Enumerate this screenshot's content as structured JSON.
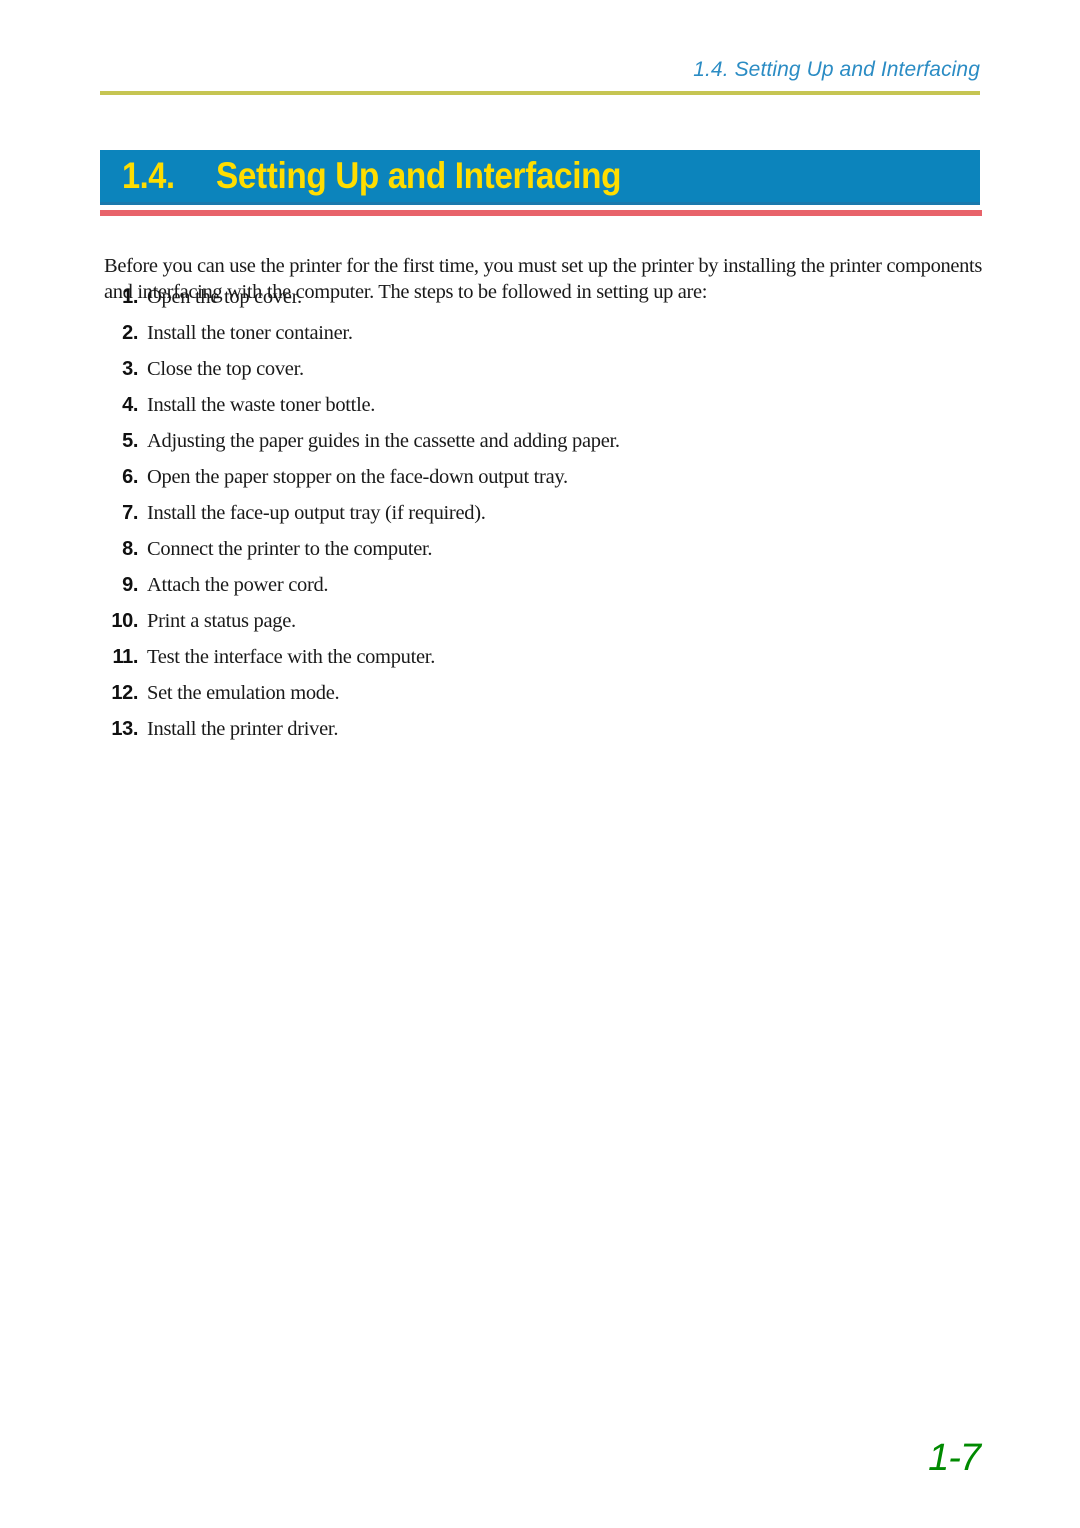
{
  "document": {
    "running_header": "1.4. Setting Up and Interfacing",
    "page_number": "1-7"
  },
  "section": {
    "number": "1.4.",
    "title": "Setting Up and Interfacing"
  },
  "body": {
    "intro": "Before you can use the printer for the first time, you must set up the printer by installing the printer components and interfacing with the computer. The steps to be followed in setting up are:"
  },
  "steps": [
    {
      "number": "1.",
      "label": "Open the top cover."
    },
    {
      "number": "2.",
      "label": "Install the toner container."
    },
    {
      "number": "3.",
      "label": "Close the top cover."
    },
    {
      "number": "4.",
      "label": "Install the waste toner bottle."
    },
    {
      "number": "5.",
      "label": "Adjusting the paper guides in the cassette and adding paper."
    },
    {
      "number": "6.",
      "label": "Open the paper stopper on the face-down output tray."
    },
    {
      "number": "7.",
      "label": "Install the face-up output tray (if required)."
    },
    {
      "number": "8.",
      "label": "Connect the printer to the computer."
    },
    {
      "number": "9.",
      "label": "Attach the power cord."
    },
    {
      "number": "10.",
      "label": "Print a status page."
    },
    {
      "number": "11.",
      "label": "Test the interface with the computer."
    },
    {
      "number": "12.",
      "label": "Set the emulation mode."
    },
    {
      "number": "13.",
      "label": "Install the printer driver."
    }
  ],
  "colors": {
    "header_text": "#2b8cc4",
    "header_rule": "#c6c552",
    "title_band": "#0c84bc",
    "title_text": "#ffdd00",
    "band_underline_blue": "#1a79ad",
    "band_underline_red": "#e8636a",
    "folio": "#008a00",
    "body_text": "#1a1a1a"
  }
}
